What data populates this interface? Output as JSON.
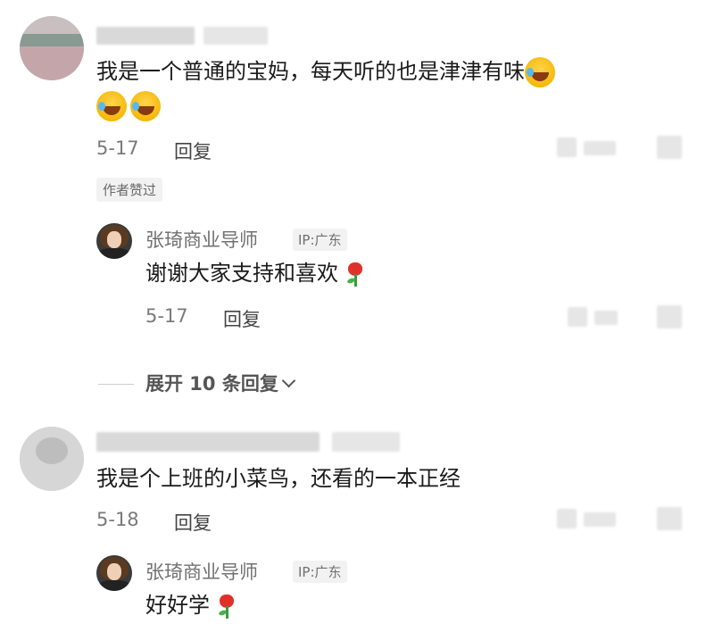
{
  "comments": [
    {
      "text_line1": "我是一个普通的宝妈，每天听的也是津津有味",
      "date": "5-17",
      "reply_label": "回复",
      "liked_badge": "作者赞过",
      "emoji_count": 3
    },
    {
      "text_line1": "我是个上班的小菜鸟，还看的一本正经",
      "date": "5-18",
      "reply_label": "回复"
    }
  ],
  "replies": [
    {
      "author": "张琦商业导师",
      "ip": "IP:广东",
      "text": "谢谢大家支持和喜欢",
      "date": "5-17",
      "reply_label": "回复",
      "emoji": "rose-icon"
    },
    {
      "author": "张琦商业导师",
      "ip": "IP:广东",
      "text": "好好学",
      "emoji": "rose-icon"
    }
  ],
  "expand_label": "展开 10 条回复",
  "colors": {
    "text": "#1a1a1a",
    "meta": "#7a7a7a",
    "badge_bg": "#f2f2f2"
  }
}
